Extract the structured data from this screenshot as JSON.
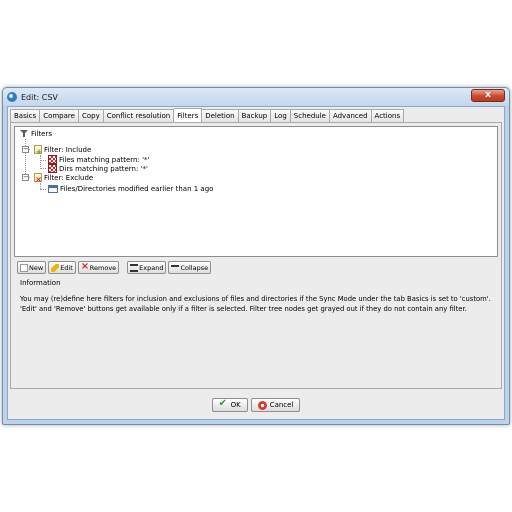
{
  "window": {
    "title": "Edit: CSV",
    "close_label": "x"
  },
  "tabs": [
    {
      "label": "Basics"
    },
    {
      "label": "Compare"
    },
    {
      "label": "Copy"
    },
    {
      "label": "Conflict resolution"
    },
    {
      "label": "Filters",
      "active": true
    },
    {
      "label": "Deletion"
    },
    {
      "label": "Backup"
    },
    {
      "label": "Log"
    },
    {
      "label": "Schedule"
    },
    {
      "label": "Advanced"
    },
    {
      "label": "Actions"
    }
  ],
  "tree": {
    "root": "Filters",
    "include": "Filter: Include",
    "files_pattern": "Files matching pattern: '*'",
    "dirs_pattern": "Dirs matching pattern: '*'",
    "exclude": "Filter: Exclude",
    "modified": "Files/Directories modified earlier than 1 ago"
  },
  "buttons": {
    "new": "New",
    "edit": "Edit",
    "remove": "Remove",
    "expand": "Expand",
    "collapse": "Collapse"
  },
  "info": {
    "title": "Information",
    "text": "You may (re)define here filters for inclusion and exclusions of files and directories if the Sync Mode under the tab Basics is set to 'custom'. 'Edit' and 'Remove' buttons get available only if a filter is selected. Filter tree nodes get grayed out if they do not contain any filter."
  },
  "footer": {
    "ok": "OK",
    "cancel": "Cancel"
  }
}
